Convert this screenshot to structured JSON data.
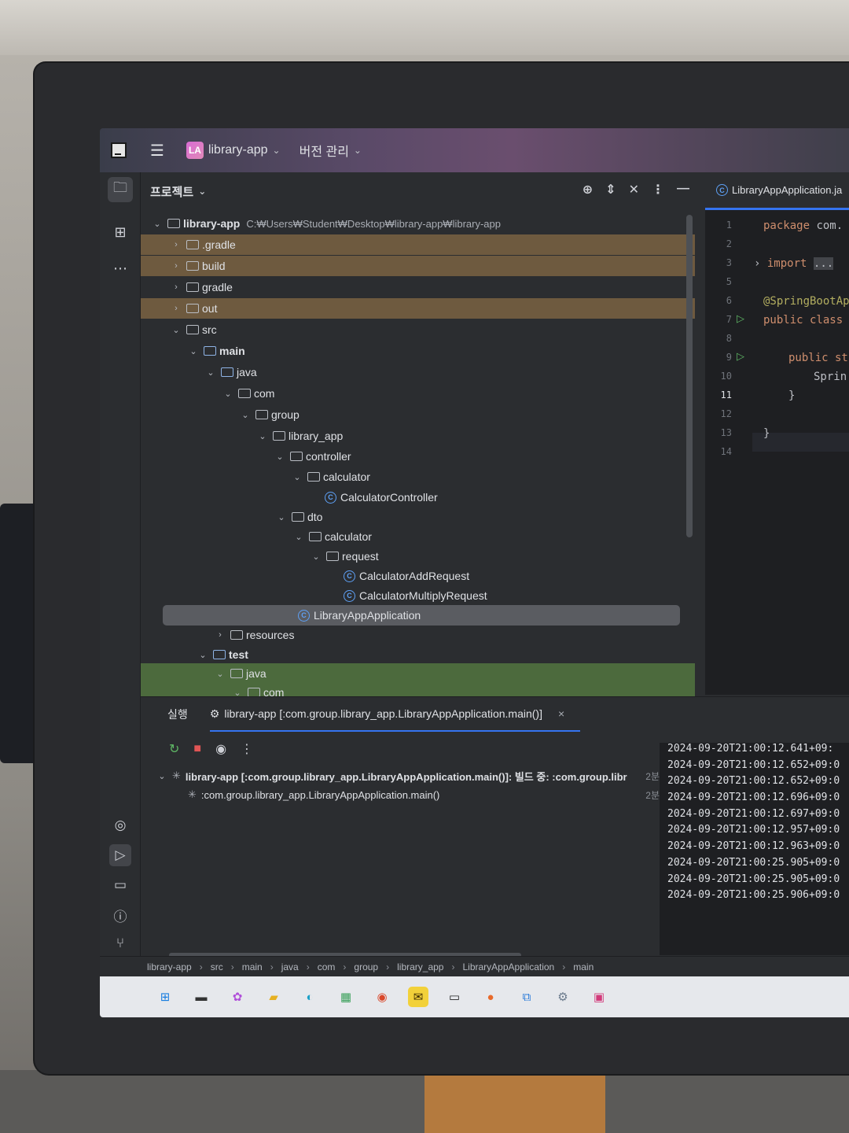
{
  "titlebar": {
    "project_badge": "LA",
    "project_name": "library-app",
    "vcs_menu": "버전 관리"
  },
  "project_panel": {
    "title": "프로젝트",
    "root": {
      "name": "library-app",
      "path": "C:₩Users₩Student₩Desktop₩library-app₩library-app"
    },
    "items": [
      {
        "label": ".gradle"
      },
      {
        "label": "build"
      },
      {
        "label": "gradle"
      },
      {
        "label": "out"
      },
      {
        "label": "src"
      },
      {
        "label": "main"
      },
      {
        "label": "java"
      },
      {
        "label": "com"
      },
      {
        "label": "group"
      },
      {
        "label": "library_app"
      },
      {
        "label": "controller"
      },
      {
        "label": "calculator"
      },
      {
        "label": "CalculatorController"
      },
      {
        "label": "dto"
      },
      {
        "label": "calculator"
      },
      {
        "label": "request"
      },
      {
        "label": "CalculatorAddRequest"
      },
      {
        "label": "CalculatorMultiplyRequest"
      },
      {
        "label": "LibraryAppApplication"
      },
      {
        "label": "resources"
      },
      {
        "label": "test"
      },
      {
        "label": "java"
      },
      {
        "label": "com"
      }
    ]
  },
  "editor": {
    "tab": "LibraryAppApplication.ja",
    "line_numbers": [
      "1",
      "2",
      "3",
      "5",
      "6",
      "7",
      "8",
      "9",
      "10",
      "11",
      "12",
      "13",
      "14"
    ],
    "code": {
      "l1_kw": "package",
      "l1_rest": "com.",
      "l3_kw": "import",
      "l3_fold": "...",
      "l6_ann": "@SpringBootAp",
      "l7_kw": "public class",
      "l9_kw": "public st",
      "l10": "Sprin",
      "l11": "}",
      "l13": "}"
    }
  },
  "run_panel": {
    "tab_label": "실행",
    "run_config": "library-app [:com.group.library_app.LibraryAppApplication.main()]",
    "tasks": [
      {
        "label": "library-app [:com.group.library_app.LibraryAppApplication.main()]: 빌드 중: :com.group.libr",
        "time": "2분"
      },
      {
        "label": ":com.group.library_app.LibraryAppApplication.main()",
        "time": "2분"
      }
    ],
    "console": [
      "2024-09-20T21:00:12.641+09:",
      "2024-09-20T21:00:12.652+09:0",
      "2024-09-20T21:00:12.652+09:0",
      "2024-09-20T21:00:12.696+09:0",
      "2024-09-20T21:00:12.697+09:0",
      "2024-09-20T21:00:12.957+09:0",
      "2024-09-20T21:00:12.963+09:0",
      "2024-09-20T21:00:25.905+09:0",
      "2024-09-20T21:00:25.905+09:0",
      "2024-09-20T21:00:25.906+09:0"
    ]
  },
  "breadcrumbs": [
    "library-app",
    "src",
    "main",
    "java",
    "com",
    "group",
    "library_app",
    "LibraryAppApplication",
    "main"
  ]
}
